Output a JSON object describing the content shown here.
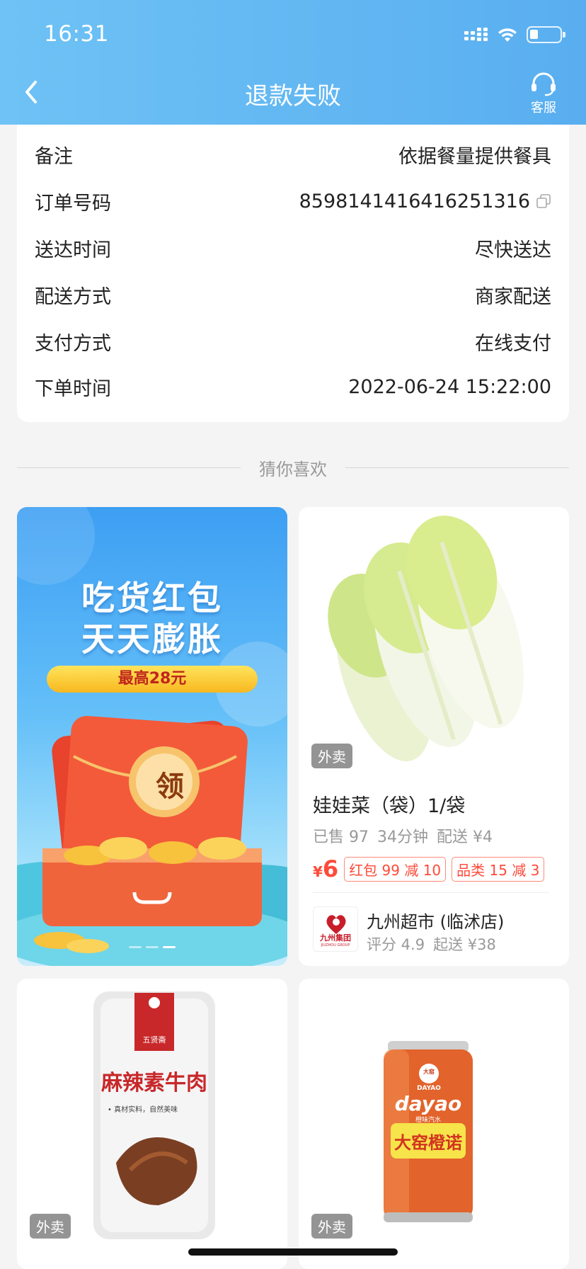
{
  "status_bar": {
    "time": "16:31"
  },
  "nav": {
    "title": "退款失败",
    "service_label": "客服"
  },
  "order_info": {
    "rows": [
      {
        "label": "备注",
        "value": "依据餐量提供餐具"
      },
      {
        "label": "订单号码",
        "value": "8598141416416251316"
      },
      {
        "label": "送达时间",
        "value": "尽快送达"
      },
      {
        "label": "配送方式",
        "value": "商家配送"
      },
      {
        "label": "支付方式",
        "value": "在线支付"
      },
      {
        "label": "下单时间",
        "value": "2022-06-24 15:22:00"
      }
    ]
  },
  "recommend": {
    "title": "猜你喜欢"
  },
  "promo": {
    "line1": "吃货红包",
    "line2": "天天膨胀",
    "pill": "最高28元",
    "badge": "领"
  },
  "product": {
    "tag": "外卖",
    "name": "娃娃菜（袋）1/袋",
    "sold": "已售 97",
    "time": "34分钟",
    "delivery": "配送 ¥4",
    "currency": "¥",
    "price": "6",
    "coupon1": "红包 99 减 10",
    "coupon2": "品类 15 减 3",
    "shop_name": "九州超市 (临沭店)",
    "shop_rating": "评分 4.9",
    "shop_min": "起送 ¥38",
    "shop_logo_text": "九州集团",
    "shop_logo_sub": "JIUZHOU GROUP"
  },
  "bottom_cards": [
    {
      "tag": "外卖",
      "brand": "五贤斋",
      "title": "麻辣素牛肉",
      "subtitle": "• 真材实料，自然美味"
    },
    {
      "tag": "外卖",
      "brand": "大窑",
      "brand_en": "DAYAO",
      "logo": "dayao",
      "flavor": "橙味汽水",
      "title": "大窑橙诺"
    }
  ],
  "colors": {
    "header": "#5db3f2",
    "accent_red": "#ff4a3a"
  }
}
